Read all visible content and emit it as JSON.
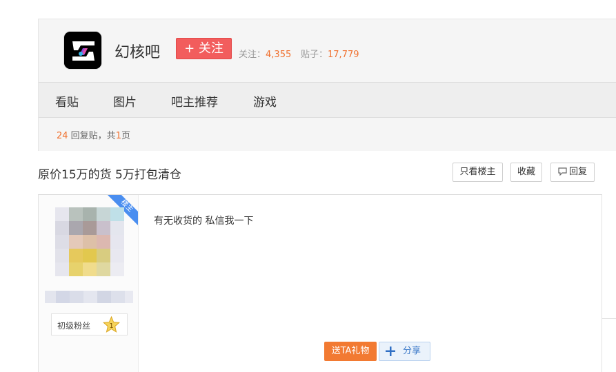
{
  "forum": {
    "name": "幻核吧",
    "follow_label": "+ 关注",
    "followers_label": "关注：",
    "followers_value": "4,355",
    "posts_label": "贴子：",
    "posts_value": "17,779",
    "logo_icon": "huanhe-logo-icon"
  },
  "nav": {
    "items": [
      {
        "label": "看贴"
      },
      {
        "label": "图片"
      },
      {
        "label": "吧主推荐"
      },
      {
        "label": "游戏"
      }
    ]
  },
  "thread": {
    "reply_count": "24",
    "reply_text_1": " 回复贴，共",
    "page_count": "1",
    "reply_text_2": "页",
    "title": "原价15万的货 5万打包清仓",
    "buttons": {
      "only_op": "只看楼主",
      "favorite": "收藏",
      "reply": "回复"
    }
  },
  "post": {
    "op_badge": "楼主",
    "fan_level_label": "初级粉丝",
    "fan_level": "1",
    "content": "有无收货的 私信我一下",
    "gift_label": "送TA礼物",
    "share_label": "分享"
  },
  "colors": {
    "accent_orange": "#f0702e",
    "follow_red": "#f25d5d",
    "badge_blue": "#4a8ef0"
  }
}
